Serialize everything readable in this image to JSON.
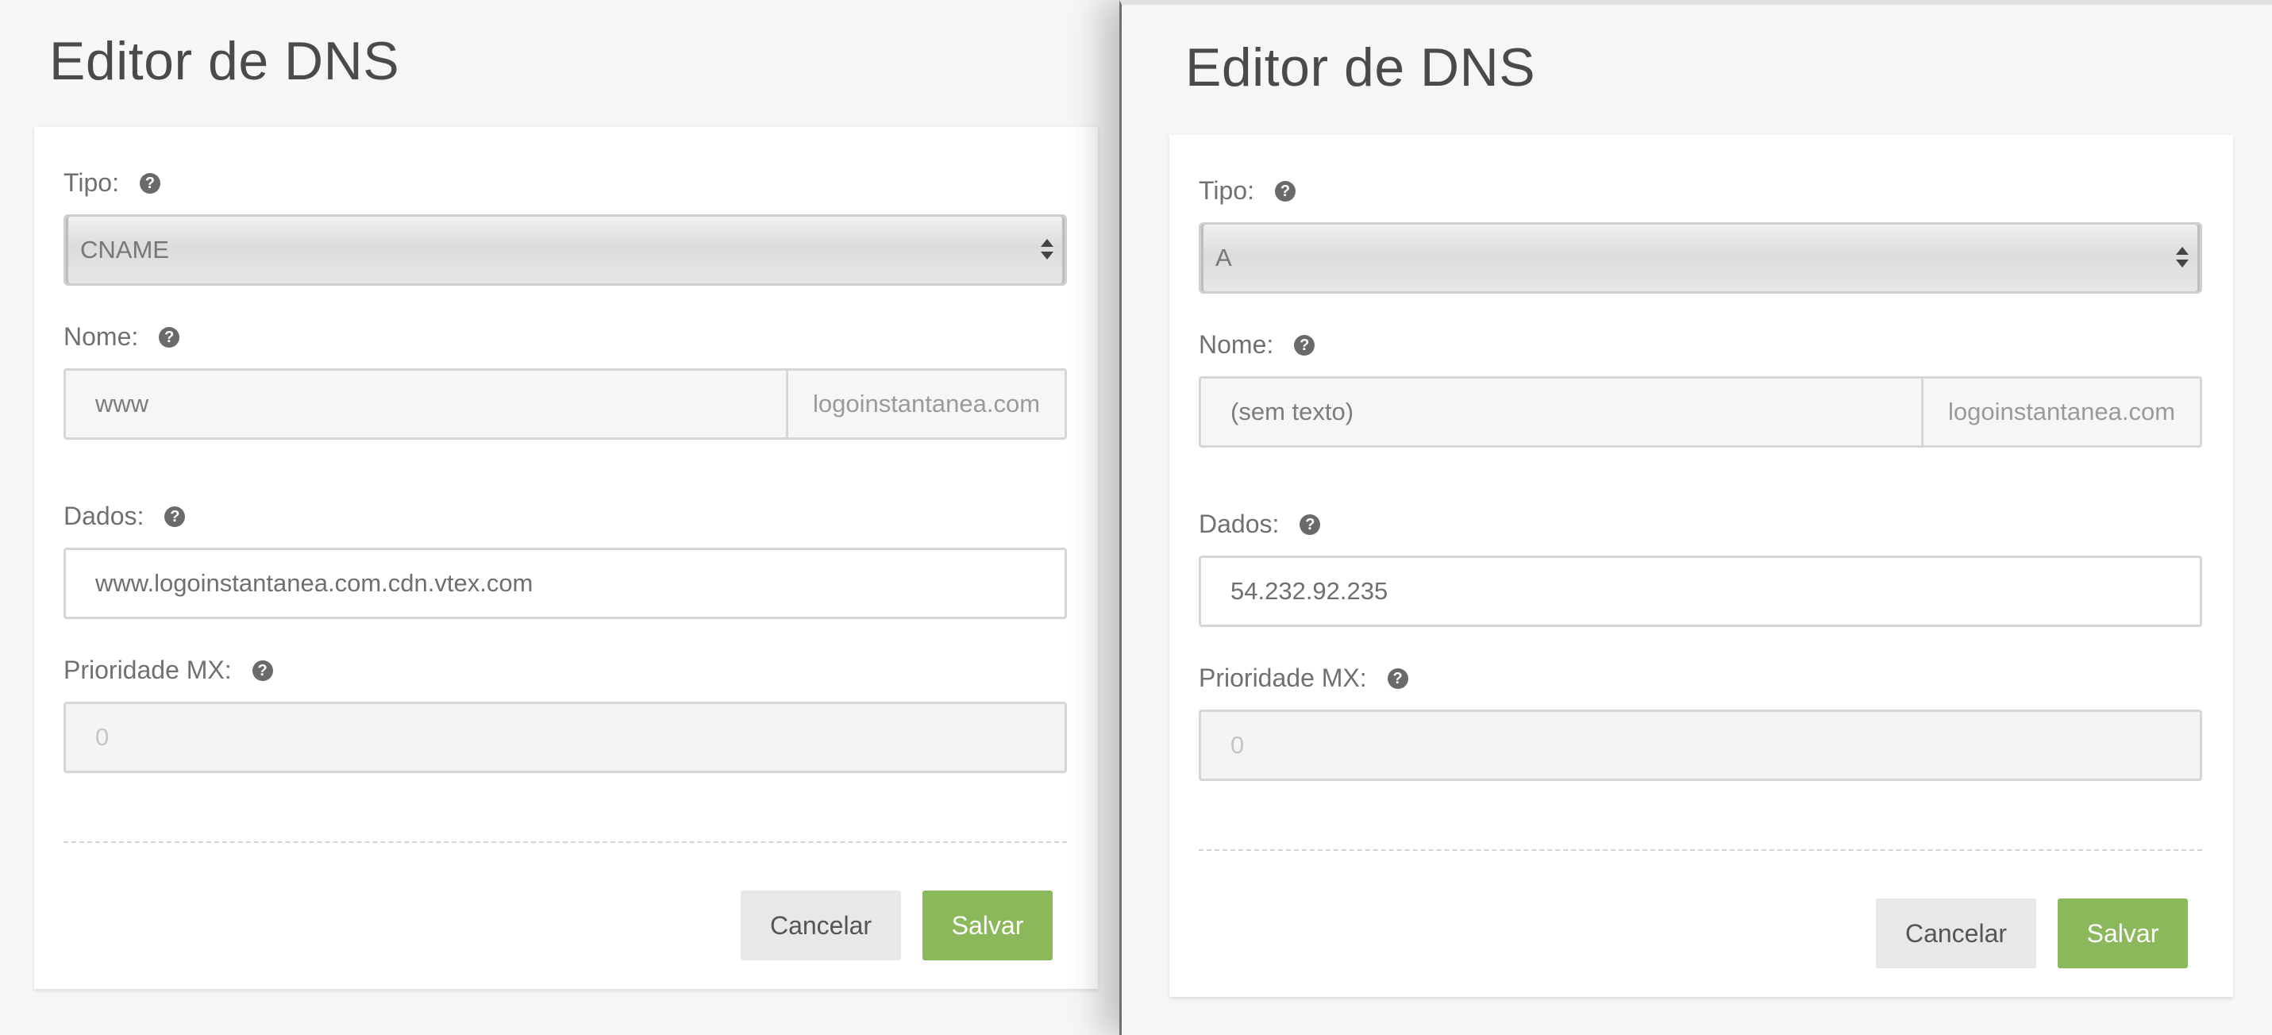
{
  "left": {
    "title": "Editor de DNS",
    "tipo_label": "Tipo:",
    "tipo_value": "CNAME",
    "nome_label": "Nome:",
    "nome_value": "www",
    "domain_suffix": "logoinstantanea.com",
    "dados_label": "Dados:",
    "dados_value": "www.logoinstantanea.com.cdn.vtex.com",
    "mx_label": "Prioridade MX:",
    "mx_value": "0",
    "cancel_label": "Cancelar",
    "save_label": "Salvar"
  },
  "right": {
    "title": "Editor de DNS",
    "tipo_label": "Tipo:",
    "tipo_value": "A",
    "nome_label": "Nome:",
    "nome_value": "(sem texto)",
    "domain_suffix": "logoinstantanea.com",
    "dados_label": "Dados:",
    "dados_value": "54.232.92.235",
    "mx_label": "Prioridade MX:",
    "mx_value": "0",
    "cancel_label": "Cancelar",
    "save_label": "Salvar"
  },
  "icons": {
    "help": "question-circle-icon",
    "select_arrows": "up-down-arrows-icon"
  },
  "colors": {
    "save_button": "#8cb85c",
    "cancel_button": "#e8e8e8",
    "background": "#f6f6f6",
    "card": "#ffffff"
  }
}
